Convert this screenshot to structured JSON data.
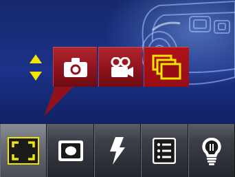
{
  "colors": {
    "accent_yellow": "#f2e500",
    "mode_red": "#9a141d",
    "toolbar_gray": "#3d4049",
    "background_blue": "#1c3288"
  },
  "scroll_indicator": {
    "icon": "up-down-arrows-icon"
  },
  "mode_bar": {
    "selected_index": 2,
    "items": [
      {
        "name": "still-photo",
        "icon": "camera-icon"
      },
      {
        "name": "movie",
        "icon": "movie-camera-icon"
      },
      {
        "name": "burst",
        "icon": "stacked-frames-icon"
      }
    ]
  },
  "toolbar": {
    "selected_index": 0,
    "items": [
      {
        "name": "focus-area",
        "icon": "focus-frame-icon"
      },
      {
        "name": "metering",
        "icon": "metering-icon"
      },
      {
        "name": "flash",
        "icon": "flash-icon"
      },
      {
        "name": "menu",
        "icon": "menu-list-icon"
      },
      {
        "name": "help",
        "icon": "lightbulb-icon"
      }
    ]
  }
}
